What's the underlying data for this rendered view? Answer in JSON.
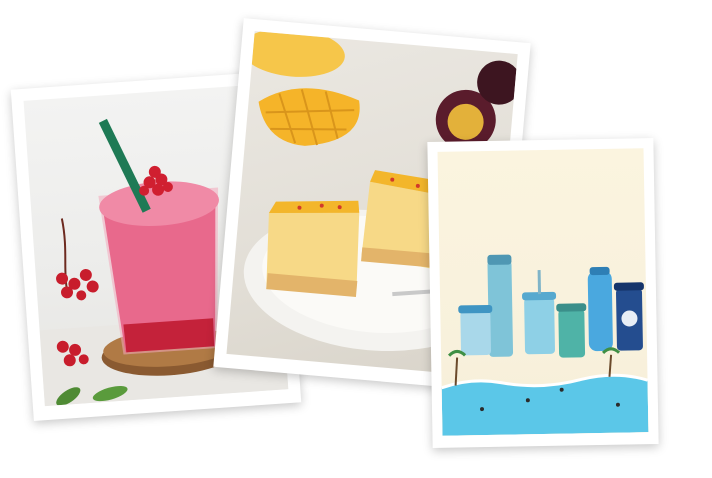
{
  "photos": [
    {
      "subject": "pink-frappuccino-drink"
    },
    {
      "subject": "mango-passionfruit-cheesecake"
    },
    {
      "subject": "summer-tumbler-collection"
    }
  ],
  "colors": {
    "drink_pink": "#e8698c",
    "straw_green": "#1e7a55",
    "berry_red": "#c81d2c",
    "mango_yellow": "#f3b62b",
    "sea_blue": "#5bc7e8",
    "sand": "#f8f1dc"
  }
}
